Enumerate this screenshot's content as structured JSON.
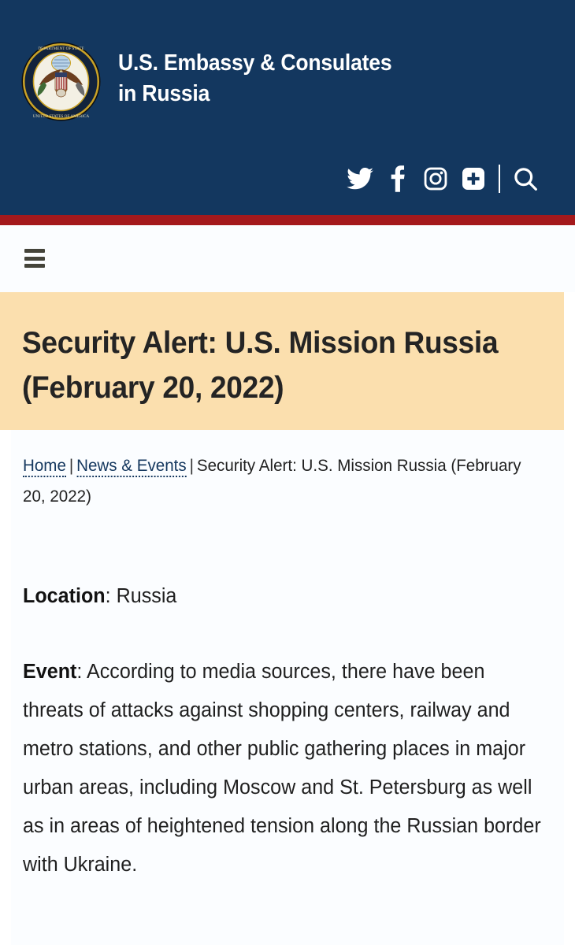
{
  "header": {
    "seal_name": "us-department-of-state-seal",
    "seal_alt": "U.S. Department of State Seal",
    "brand_line1": "U.S. Embassy & Consulates",
    "brand_line2": "in Russia",
    "navy": "#13375f",
    "red_rule": "#a4191c",
    "icons": [
      {
        "name": "twitter-icon",
        "label": "Twitter"
      },
      {
        "name": "facebook-icon",
        "label": "Facebook"
      },
      {
        "name": "instagram-icon",
        "label": "Instagram"
      },
      {
        "name": "more-plus-icon",
        "label": "More"
      },
      {
        "name": "search-icon",
        "label": "Search"
      }
    ]
  },
  "nav": {
    "menu_button_label": "Menu"
  },
  "banner": {
    "background": "#fbdfae",
    "title_line1": "Security Alert: U.S. Mission Russia",
    "title_line2": "(February 20, 2022)"
  },
  "breadcrumb": {
    "home": "Home",
    "section": "News & Events",
    "separator": "|",
    "current": "Security Alert: U.S. Mission Russia (February 20, 2022)",
    "link_color": "#14375e"
  },
  "article": {
    "location_label": "Location",
    "location_value": ": Russia",
    "event_label": "Event",
    "event_value": ":  According to media sources, there have been threats of attacks against shopping centers, railway and metro stations, and other public gathering places in major urban areas, including Moscow and St. Petersburg as well as in areas of heightened tension along the Russian border with Ukraine."
  }
}
